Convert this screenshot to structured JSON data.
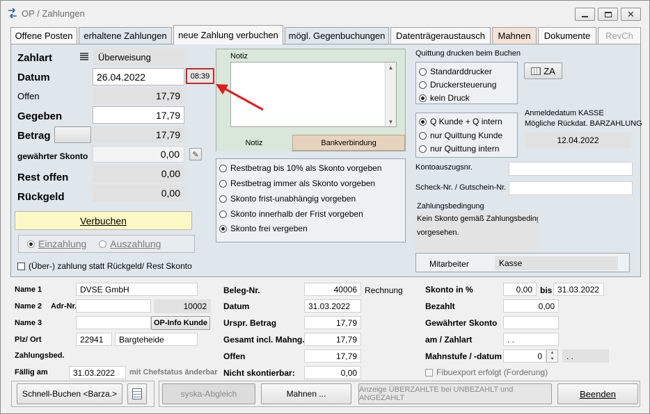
{
  "window": {
    "title": "OP / Zahlungen"
  },
  "tabs": [
    {
      "label": "Offene Posten"
    },
    {
      "label": "erhaltene Zahlungen"
    },
    {
      "label": "neue Zahlung verbuchen"
    },
    {
      "label": "mögl. Gegenbuchungen"
    },
    {
      "label": "Datenträgeraustausch"
    },
    {
      "label": "Mahnen"
    },
    {
      "label": "Dokumente"
    },
    {
      "label": "RevCh"
    }
  ],
  "payment": {
    "zahlart_label": "Zahlart",
    "zahlart_value": "Überweisung",
    "datum_label": "Datum",
    "datum_value": "26.04.2022",
    "time_value": "08:39",
    "offen_label": "Offen",
    "offen_value": "17,79",
    "gegeben_label": "Gegeben",
    "gegeben_value": "17,79",
    "betrag_label": "Betrag",
    "betrag_value": "17,79",
    "skonto_label": "gewährter Skonto",
    "skonto_value": "0,00",
    "rest_label": "Rest offen",
    "rest_value": "0,00",
    "rueckgeld_label": "Rückgeld",
    "rueckgeld_value": "0,00",
    "verbuchen_label": "Verbuchen",
    "einzahlung_label": "Einzahlung",
    "auszahlung_label": "Auszahlung",
    "checkbox_label": "(Über-) zahlung statt Rückgeld/ Rest Skonto"
  },
  "notiz": {
    "label": "Notiz",
    "tab_notiz": "Notiz",
    "tab_bank": "Bankverbindung"
  },
  "skonto_options": [
    {
      "label": "Restbetrag bis 10% als Skonto vorgeben",
      "selected": false
    },
    {
      "label": "Restbetrag immer als Skonto vorgeben",
      "selected": false
    },
    {
      "label": "Skonto frist-unabhängig vorgeben",
      "selected": false
    },
    {
      "label": "Skonto innerhalb der Frist vorgeben",
      "selected": false
    },
    {
      "label": "Skonto frei vergeben",
      "selected": true
    }
  ],
  "quittung": {
    "title": "Quittung drucken beim Buchen",
    "options": [
      {
        "label": "Standarddrucker",
        "selected": false
      },
      {
        "label": "Druckersteuerung",
        "selected": false
      },
      {
        "label": "kein Druck",
        "selected": true
      }
    ],
    "za_label": "ZA",
    "options2": [
      {
        "label": "Q Kunde + Q intern",
        "selected": true
      },
      {
        "label": "nur Quittung Kunde",
        "selected": false
      },
      {
        "label": "nur Quittung intern",
        "selected": false
      }
    ],
    "anmelde_line1": "Anmeldedatum KASSE",
    "anmelde_line2": "Mögliche Rückdat. BARZAHLUNG",
    "anmelde_date": "12.04.2022",
    "konto_label": "Kontoauszugsnr.",
    "scheck_label": "Scheck-Nr. / Gutschein-Nr.",
    "zb_label": "Zahlungsbedingung",
    "zb_text1": "Kein Skonto gemäß Zahlungsbeding",
    "zb_text2": "vorgesehen.",
    "mitarbeiter_label": "Mitarbeiter",
    "mitarbeiter_value": "Kasse"
  },
  "details": {
    "name1_label": "Name 1",
    "name1_value": "DVSE GmbH",
    "name2_label": "Name 2",
    "adr_label": "Adr-Nr.",
    "adr_value": "10002",
    "name3_label": "Name 3",
    "opinfo_label": "OP-Info Kunde",
    "plz_label": "Plz/ Ort",
    "plz_value": "22941",
    "ort_value": "Bargteheide",
    "zb_label": "Zahlungsbed.",
    "faellig_label": "Fällig am",
    "faellig_value": "31.03.2022",
    "chef_label": "mit Chefstatus änderbar",
    "beleg_label": "Beleg-Nr.",
    "beleg_value": "40006",
    "beleg_type": "Rechnung",
    "datum_label": "Datum",
    "datum_value": "31.03.2022",
    "urspr_label": "Urspr. Betrag",
    "urspr_value": "17,79",
    "gesamt_label": "Gesamt incl. Mahng.",
    "gesamt_value": "17,79",
    "offen_label": "Offen",
    "offen_value": "17,79",
    "nicht_label": "Nicht skontierbar:",
    "nicht_value": "0,00",
    "skontop_label": "Skonto in %",
    "skontop_value": "0,00",
    "bis_label": "bis",
    "bis_value": "31.03.2022",
    "bezahlt_label": "Bezahlt",
    "bezahlt_value": "0,00",
    "gewskonto_label": "Gewährter Skonto",
    "amzahlart_label": "am / Zahlart",
    "amzahlart_value": ". .",
    "mahnstufe_label": "Mahnstufe / -datum",
    "mahnstufe_value": "0",
    "mahndatum_value": ". .",
    "fibu_label": "Fibuexport erfolgt (Forderung)"
  },
  "footer": {
    "schnell_label": "Schnell-Buchen <Barza.>",
    "syska_label": "syska-Abgleich",
    "mahnen_label": "Mahnen ...",
    "anzeige_label": "Anzeige ÜBERZAHLTE bei UNBEZAHLT und ANGEZAHLT",
    "beenden_label": "Beenden"
  }
}
